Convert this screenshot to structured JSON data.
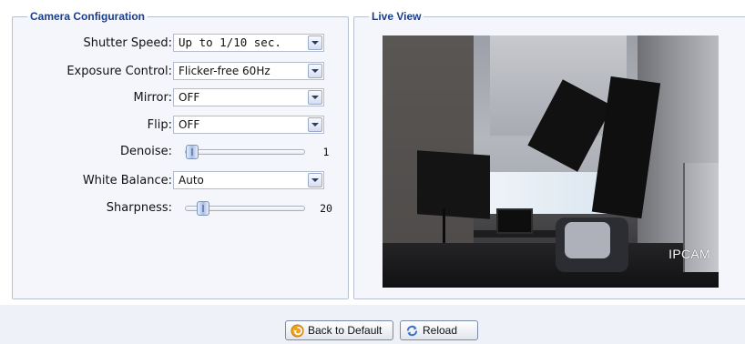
{
  "camera_config": {
    "legend": "Camera Configuration",
    "shutter_speed": {
      "label": "Shutter Speed:",
      "value": "Up to 1/10 sec."
    },
    "exposure_control": {
      "label": "Exposure Control:",
      "value": "Flicker-free 60Hz"
    },
    "mirror": {
      "label": "Mirror:",
      "value": "OFF"
    },
    "flip": {
      "label": "Flip:",
      "value": "OFF"
    },
    "denoise": {
      "label": "Denoise:",
      "value": "1"
    },
    "white_balance": {
      "label": "White Balance:",
      "value": "Auto"
    },
    "sharpness": {
      "label": "Sharpness:",
      "value": "20"
    }
  },
  "live_view": {
    "legend": "Live View",
    "overlay_text": "IPCAM"
  },
  "buttons": {
    "back_to_default": {
      "label": "Back to Default",
      "icon": "undo-arrow-icon"
    },
    "reload": {
      "label": "Reload",
      "icon": "refresh-icon"
    }
  },
  "colors": {
    "legend_text": "#1a3e88",
    "panel_bg": "#f4f6fc",
    "border": "#b8c1cf"
  }
}
